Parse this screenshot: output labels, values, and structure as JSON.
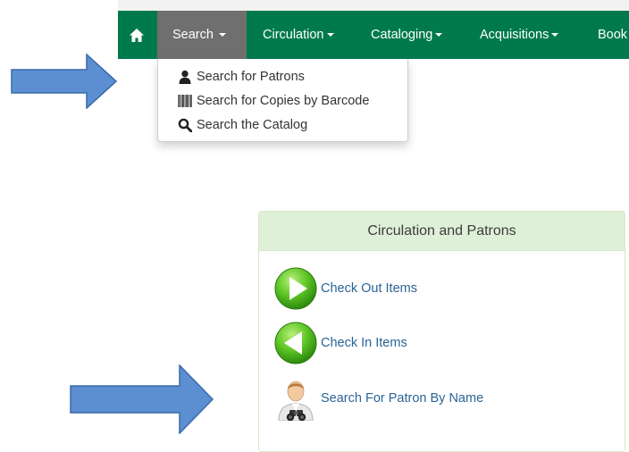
{
  "navbar": {
    "items": [
      {
        "label": "Search"
      },
      {
        "label": "Circulation"
      },
      {
        "label": "Cataloging"
      },
      {
        "label": "Acquisitions"
      },
      {
        "label": "Book"
      }
    ],
    "color": "#007a4d",
    "active_color": "#6f6f6f"
  },
  "search_menu": {
    "items": [
      {
        "label": "Search for Patrons",
        "icon": "user-icon"
      },
      {
        "label": "Search for Copies by Barcode",
        "icon": "barcode-icon"
      },
      {
        "label": "Search the Catalog",
        "icon": "magnifier-icon"
      }
    ]
  },
  "panel": {
    "title": "Circulation and Patrons",
    "links": [
      {
        "label": "Check Out Items",
        "icon": "check-out-icon"
      },
      {
        "label": "Check In Items",
        "icon": "check-in-icon"
      },
      {
        "label": "Search For Patron By Name",
        "icon": "patron-binoculars-icon"
      }
    ]
  },
  "annotation_color": "#5b8fd1"
}
